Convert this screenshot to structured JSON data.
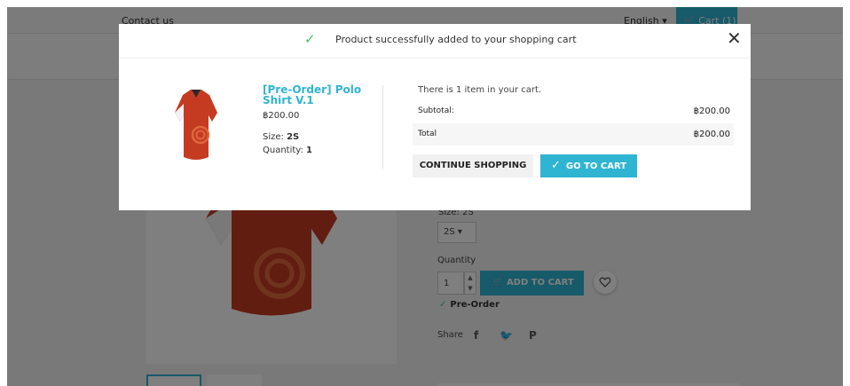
{
  "background": {
    "top_nav": {
      "contact_label": "Contact us",
      "language": "English ▾",
      "cart_label": "Cart (1)"
    },
    "product": {
      "size_label": "Size: 2S",
      "size_value": "2S ▾",
      "quantity_label": "Quantity",
      "quantity_value": "1",
      "add_to_cart_label": "ADD TO CART",
      "availability": "Pre-Order",
      "share_label": "Share"
    }
  },
  "modal": {
    "success_message": "Product successfully added to your shopping cart",
    "close_glyph": "✕",
    "product": {
      "name": "[Pre-Order] Polo Shirt V.1",
      "price": "฿200.00",
      "size_label": "Size:",
      "size_value": "2S",
      "quantity_label": "Quantity:",
      "quantity_value": "1"
    },
    "cart": {
      "items_message": "There is 1 item in your cart.",
      "subtotal_label": "Subtotal:",
      "subtotal_value": "฿200.00",
      "total_label": "Total",
      "total_value": "฿200.00"
    },
    "continue_label": "CONTINUE SHOPPING",
    "goto_cart_label": "GO TO CART"
  },
  "colors": {
    "accent": "#2fb5d2",
    "success": "#4cbb6c",
    "overlay": "rgba(0,0,0,0.5)"
  }
}
